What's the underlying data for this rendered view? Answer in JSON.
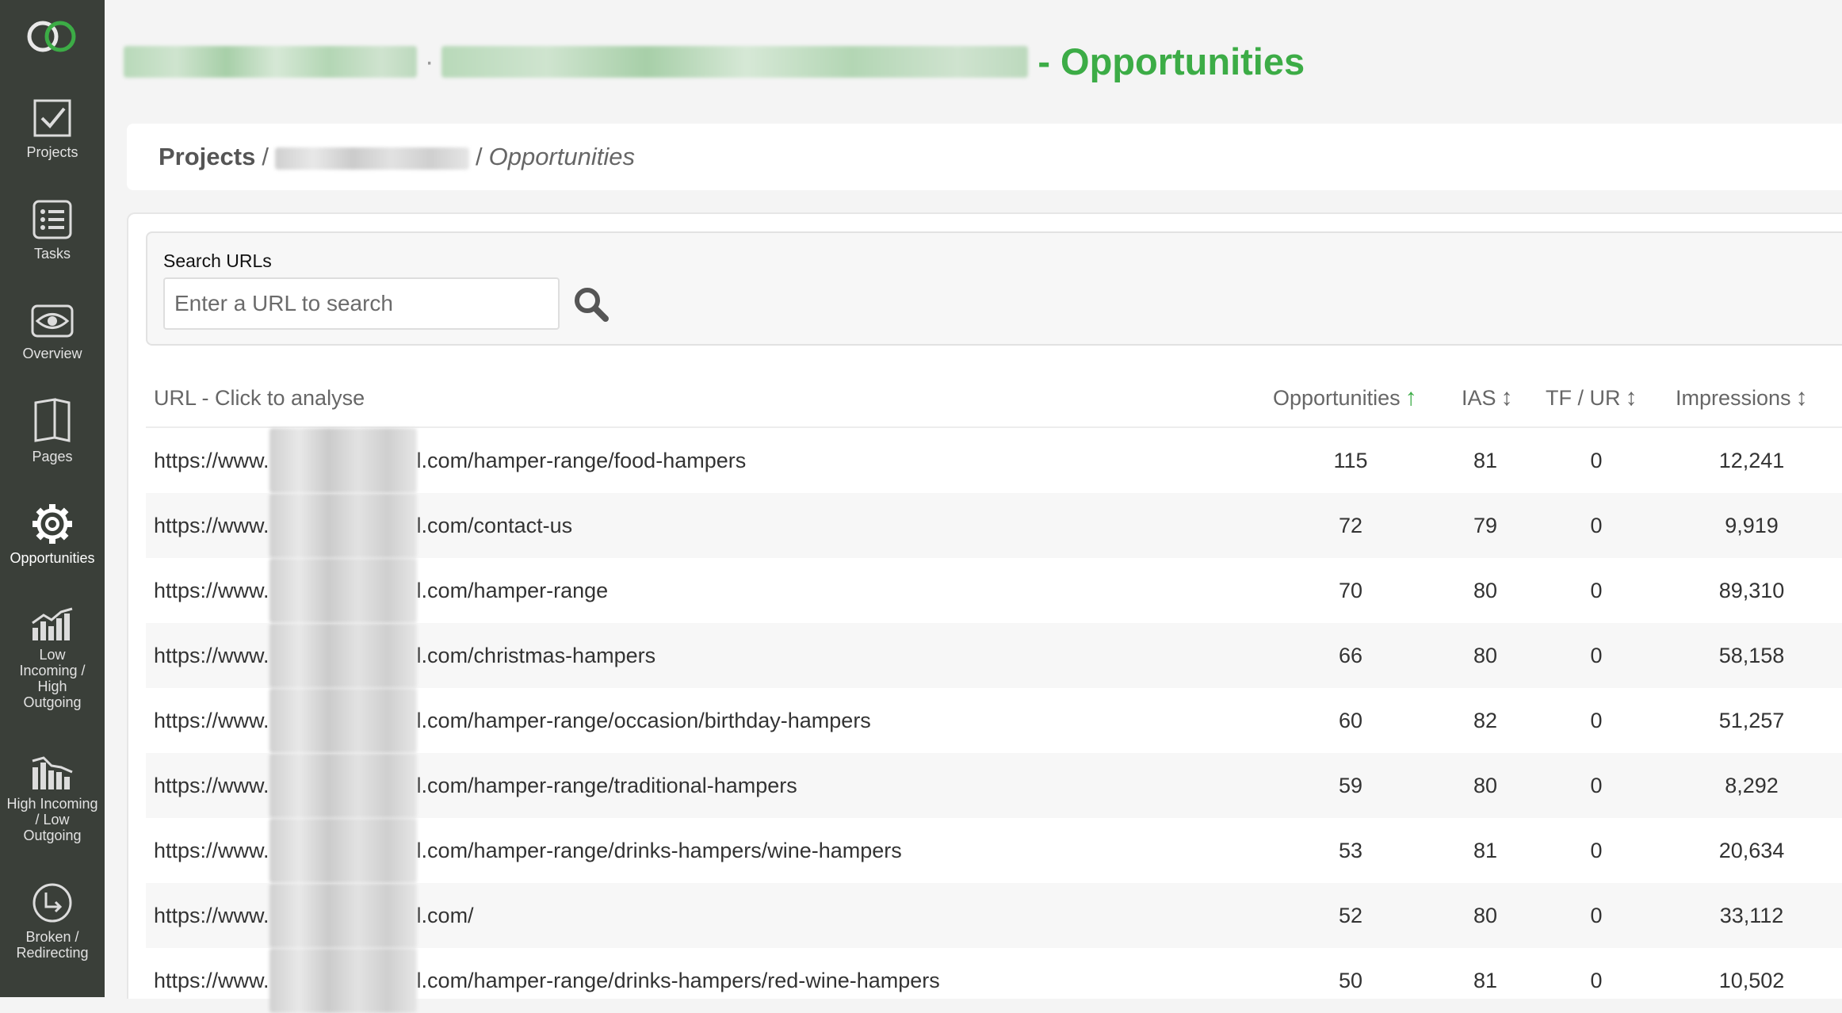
{
  "app": {
    "logo_icon": "infinity-logo-icon",
    "accent_color": "#3cac46"
  },
  "sidebar": {
    "items": [
      {
        "label": "Projects",
        "icon": "checkbox-icon"
      },
      {
        "label": "Tasks",
        "icon": "list-icon"
      },
      {
        "label": "Overview",
        "icon": "eye-icon"
      },
      {
        "label": "Pages",
        "icon": "pages-icon"
      },
      {
        "label": "Opportunities",
        "icon": "gear-icon",
        "active": true
      },
      {
        "label": "Low Incoming / High Outgoing",
        "icon": "bar-chart-icon"
      },
      {
        "label": "High Incoming / Low Outgoing",
        "icon": "bar-chart-icon"
      },
      {
        "label": "Broken / Redirecting",
        "icon": "redirect-arrow-icon"
      }
    ]
  },
  "header": {
    "title_suffix": "- Opportunities"
  },
  "breadcrumb": {
    "root": "Projects",
    "separator": "/",
    "current": "Opportunities"
  },
  "search": {
    "label": "Search URLs",
    "placeholder": "Enter a URL to search",
    "icon": "search-icon"
  },
  "table": {
    "columns": {
      "url": "URL - Click to analyse",
      "opportunities": "Opportunities",
      "ias": "IAS",
      "tf_ur": "TF / UR",
      "impressions": "Impressions"
    },
    "rows": [
      {
        "url_prefix": "https://www.",
        "url_suffix": "l.com/hamper-range/food-hampers",
        "opportunities": "115",
        "ias": "81",
        "tf_ur": "0",
        "impressions": "12,241"
      },
      {
        "url_prefix": "https://www.",
        "url_suffix": "l.com/contact-us",
        "opportunities": "72",
        "ias": "79",
        "tf_ur": "0",
        "impressions": "9,919"
      },
      {
        "url_prefix": "https://www.",
        "url_suffix": "l.com/hamper-range",
        "opportunities": "70",
        "ias": "80",
        "tf_ur": "0",
        "impressions": "89,310"
      },
      {
        "url_prefix": "https://www.",
        "url_suffix": "l.com/christmas-hampers",
        "opportunities": "66",
        "ias": "80",
        "tf_ur": "0",
        "impressions": "58,158"
      },
      {
        "url_prefix": "https://www.",
        "url_suffix": "l.com/hamper-range/occasion/birthday-hampers",
        "opportunities": "60",
        "ias": "82",
        "tf_ur": "0",
        "impressions": "51,257"
      },
      {
        "url_prefix": "https://www.",
        "url_suffix": "l.com/hamper-range/traditional-hampers",
        "opportunities": "59",
        "ias": "80",
        "tf_ur": "0",
        "impressions": "8,292"
      },
      {
        "url_prefix": "https://www.",
        "url_suffix": "l.com/hamper-range/drinks-hampers/wine-hampers",
        "opportunities": "53",
        "ias": "81",
        "tf_ur": "0",
        "impressions": "20,634"
      },
      {
        "url_prefix": "https://www.",
        "url_suffix": "l.com/",
        "opportunities": "52",
        "ias": "80",
        "tf_ur": "0",
        "impressions": "33,112"
      },
      {
        "url_prefix": "https://www.",
        "url_suffix": "l.com/hamper-range/drinks-hampers/red-wine-hampers",
        "opportunities": "50",
        "ias": "81",
        "tf_ur": "0",
        "impressions": "10,502"
      }
    ]
  }
}
